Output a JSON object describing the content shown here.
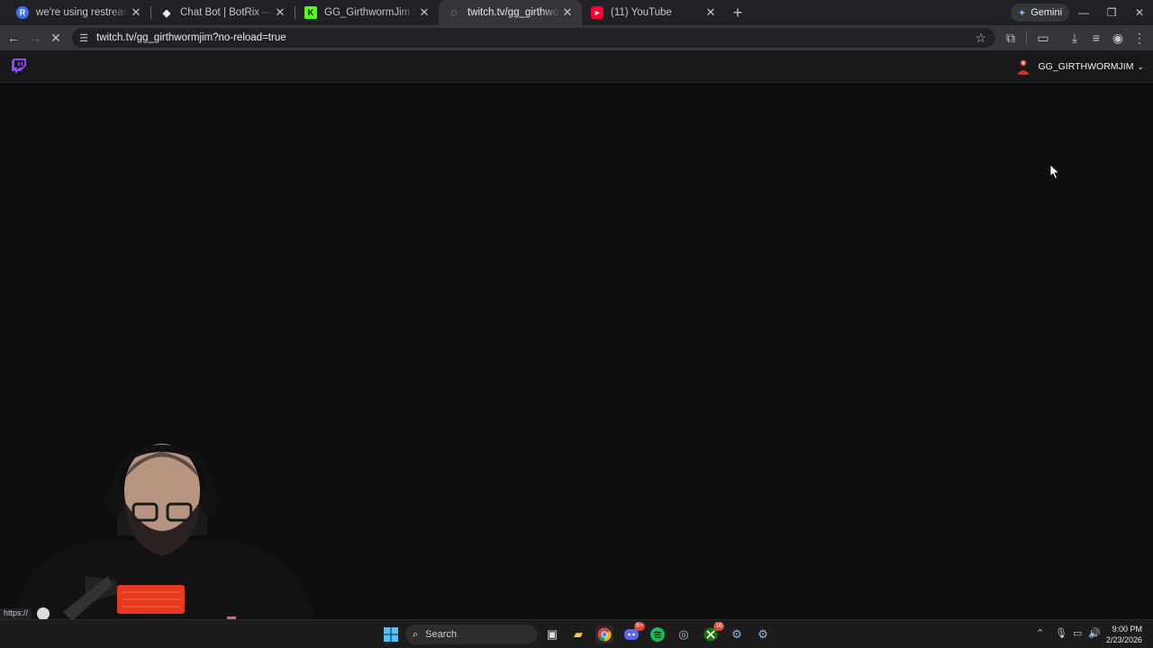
{
  "tabs": [
    {
      "title": "we're using restream and editi",
      "icon": "restream-icon",
      "color": "#3a6ff7",
      "glyph": "R"
    },
    {
      "title": "Chat Bot | BotRix — Cloud Stre",
      "icon": "botrix-icon",
      "color": "#ffffff",
      "glyph": "◆"
    },
    {
      "title": "GG_GirthwormJim Stream - Wa",
      "icon": "kick-icon",
      "color": "#53fc18",
      "glyph": "K"
    },
    {
      "title": "twitch.tv/gg_girthwormjim?no-",
      "icon": "loading-spinner-icon",
      "color": "#c4c7c5",
      "glyph": "◌",
      "active": true
    },
    {
      "title": "(11) YouTube",
      "icon": "youtube-icon",
      "color": "#ff0033",
      "glyph": "▶"
    }
  ],
  "gemini_label": "Gemini",
  "omnibox": {
    "url": "twitch.tv/gg_girthwormjim?no-reload=true"
  },
  "twitch": {
    "username": "GG_GIRTHWORMJIM"
  },
  "status_url": "https://",
  "taskbar": {
    "search_label": "Search",
    "discord_badge": "9+",
    "xbox_badge": "16",
    "time": "9:00 PM",
    "date": "2/23/2026"
  },
  "colors": {
    "twitch_purple": "#9146ff",
    "tab_active": "#35363a",
    "page_bg": "#0e0e10"
  }
}
